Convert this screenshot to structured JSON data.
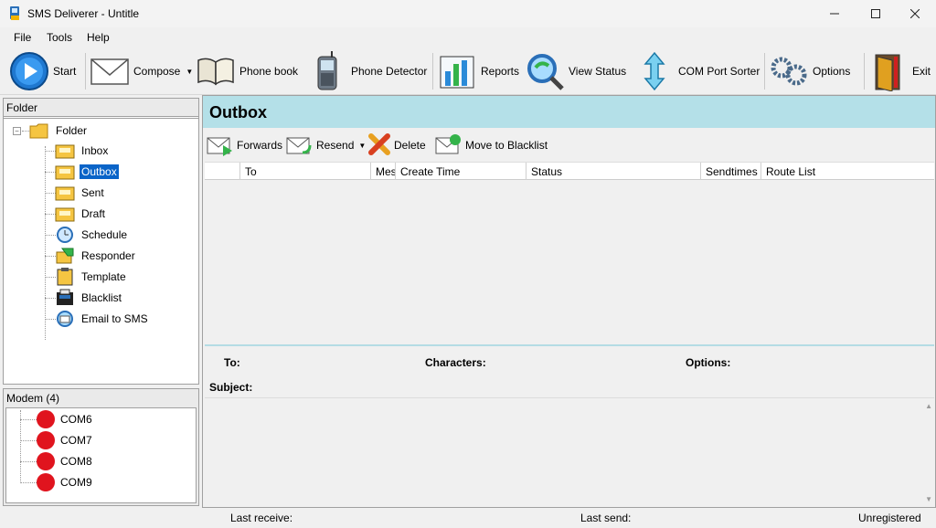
{
  "window": {
    "title": "SMS Deliverer - Untitle"
  },
  "menu": {
    "items": [
      "File",
      "Tools",
      "Help"
    ]
  },
  "toolbar": {
    "start": "Start",
    "compose": "Compose",
    "phonebook": "Phone book",
    "phone_detector": "Phone Detector",
    "reports": "Reports",
    "view_status": "View Status",
    "com_port_sorter": "COM Port Sorter",
    "options": "Options",
    "exit": "Exit"
  },
  "folder_panel": {
    "header": "Folder",
    "root": "Folder",
    "items": [
      "Inbox",
      "Outbox",
      "Sent",
      "Draft",
      "Schedule",
      "Responder",
      "Template",
      "Blacklist",
      "Email to SMS"
    ],
    "selected": "Outbox"
  },
  "modem_panel": {
    "header": "Modem (4)",
    "items": [
      "COM6",
      "COM7",
      "COM8",
      "COM9"
    ],
    "status_color": "#e0141e"
  },
  "main": {
    "title": "Outbox",
    "title_bg": "#b4e0e8",
    "actions": {
      "forwards": "Forwards",
      "resend": "Resend",
      "delete": "Delete",
      "move_to_blacklist": "Move to Blacklist"
    },
    "columns": [
      "",
      "To",
      "Mes",
      "Create Time",
      "Status",
      "Sendtimes",
      "Route List"
    ],
    "details": {
      "to": "To:",
      "characters": "Characters:",
      "options": "Options:",
      "subject": "Subject:"
    }
  },
  "statusbar": {
    "last_receive": "Last receive:",
    "last_send": "Last send:",
    "registration": "Unregistered"
  }
}
